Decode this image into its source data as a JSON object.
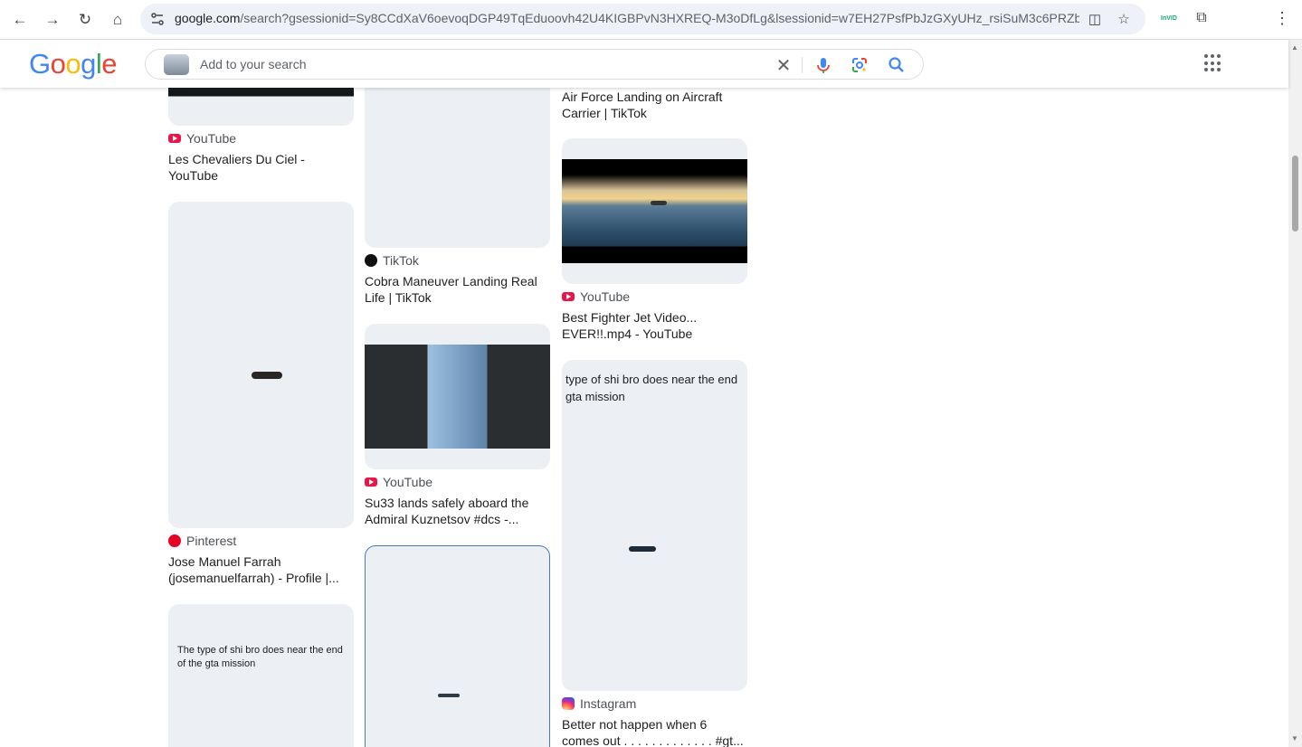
{
  "browser": {
    "url_host": "google.com",
    "url_path": "/search?gsessionid=Sy8CCdXaV6oevoqDGP49TqEduoovh42U4KIGBPvN3HXREQ-M3oDfLg&lsessionid=w7EH27PsfPbJzGXyUHz_rsiSuM3c6PRZbE50E...",
    "ext_label": "InVID"
  },
  "google": {
    "logo": [
      "G",
      "o",
      "o",
      "g",
      "l",
      "e"
    ],
    "logo_colors": [
      "#4285F4",
      "#EA4335",
      "#FBBC05",
      "#4285F4",
      "#34A853",
      "#EA4335"
    ],
    "search_placeholder": "Add to your search"
  },
  "results": [
    {
      "source": "YouTube",
      "title": "Les Chevaliers Du Ciel - YouTube"
    },
    {
      "source": "Pinterest",
      "title": "Jose Manuel Farrah (josemanuelfarrah) - Profile |..."
    },
    {
      "source": "TikTok",
      "title": "Cobra Maneuver Landing Real Life | TikTok"
    },
    {
      "source": "YouTube",
      "title": "Su33 lands safely aboard the Admiral Kuznetsov #dcs -..."
    },
    {
      "source": "",
      "title": "Air Force Landing on Aircraft Carrier | TikTok"
    },
    {
      "source": "YouTube",
      "title": "Best Fighter Jet Video... EVER!!.mp4 - YouTube"
    },
    {
      "source": "Instagram",
      "title": "Better not happen when 6 comes out . . . . . . . . . . . . . #gt..."
    }
  ],
  "image_captions": {
    "instagram_overlay": "type of shi bro does near the end gta mission",
    "bottom_left_overlay": "The type of shi bro does near the end of the gta mission"
  },
  "colors": {
    "youtube": "#e8174b",
    "pinterest": "#e60023",
    "tiktok": "#111111"
  }
}
